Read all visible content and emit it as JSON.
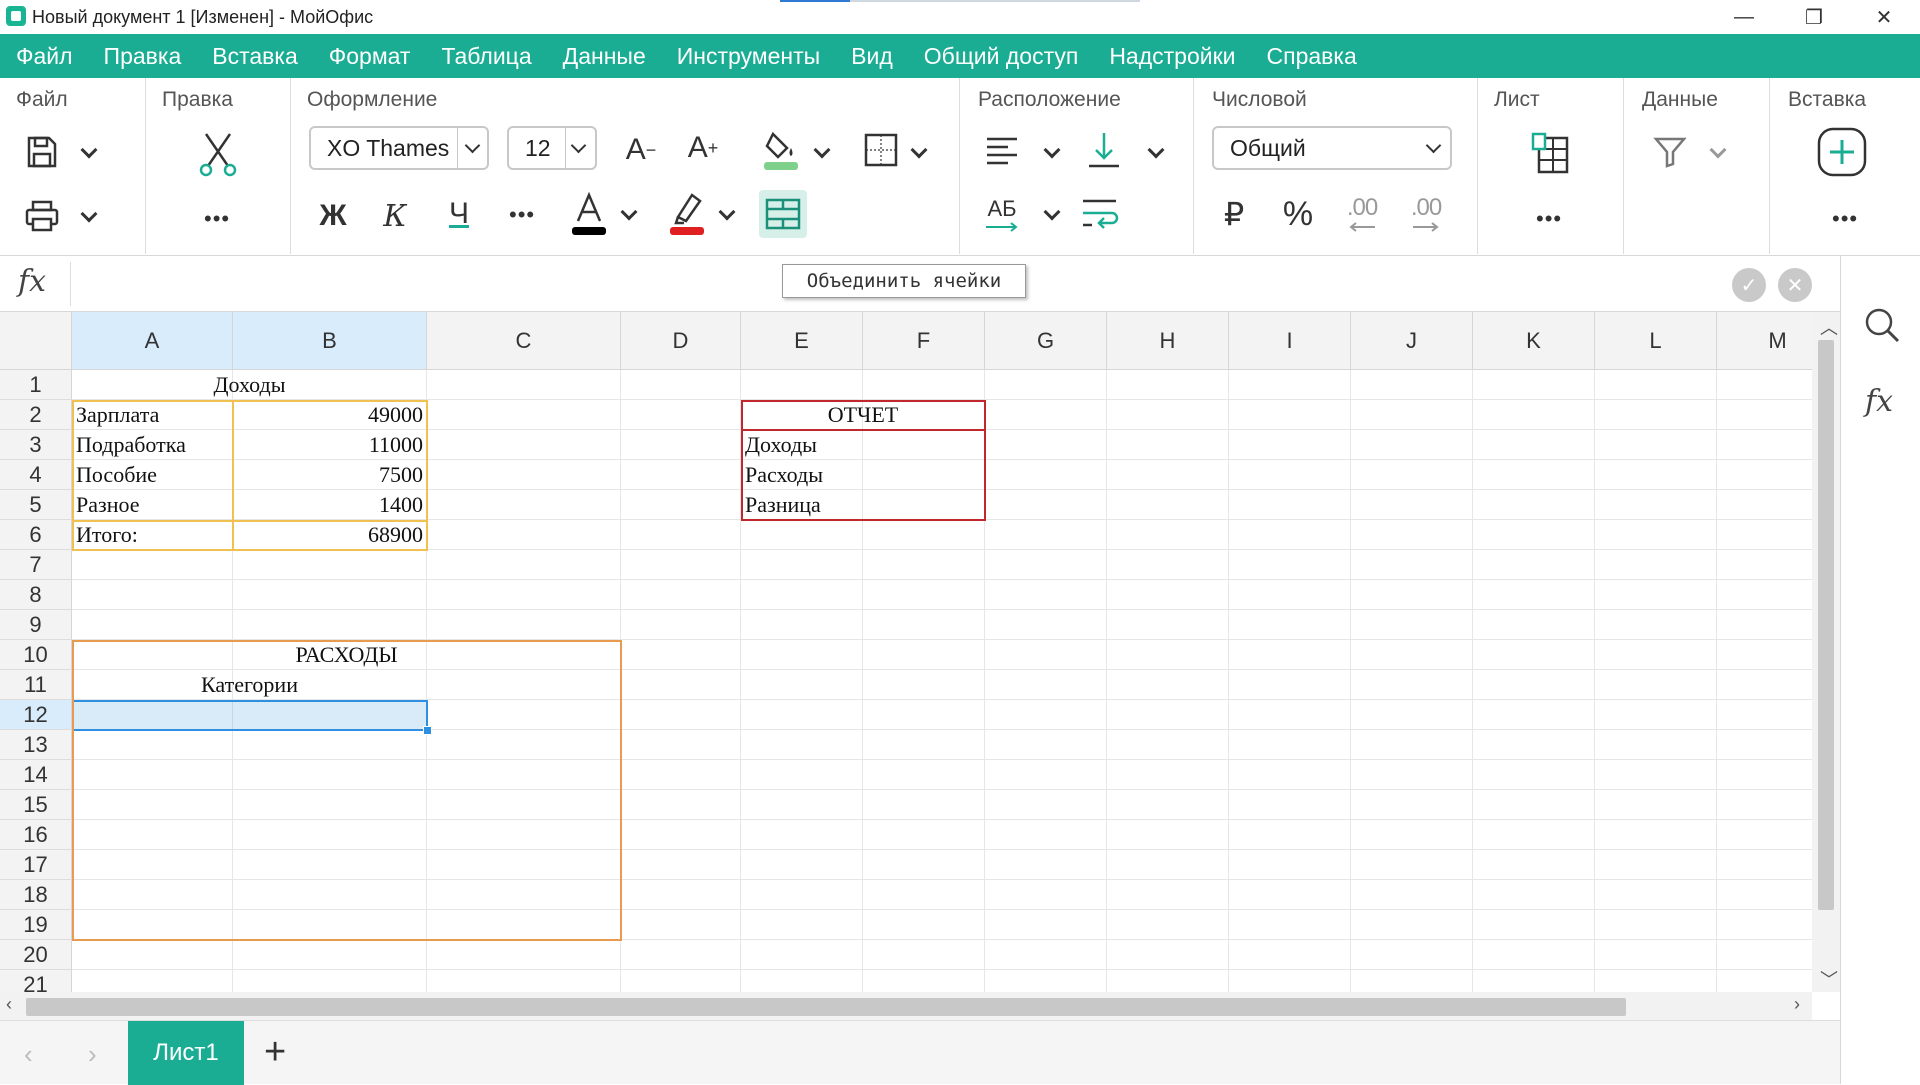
{
  "window": {
    "title": "Новый документ 1 [Изменен] - МойОфис",
    "minimize": "—",
    "restore": "❐",
    "close": "✕"
  },
  "menu": [
    "Файл",
    "Правка",
    "Вставка",
    "Формат",
    "Таблица",
    "Данные",
    "Инструменты",
    "Вид",
    "Общий доступ",
    "Надстройки",
    "Справка"
  ],
  "ribbon": {
    "groups": {
      "file": "Файл",
      "edit": "Правка",
      "format": "Оформление",
      "layout": "Расположение",
      "number": "Числовой",
      "sheet": "Лист",
      "data": "Данные",
      "insert": "Вставка"
    },
    "font_name": "XO Thames",
    "font_size": "12",
    "number_format": "Общий",
    "bold": "Ж",
    "italic": "К",
    "underline": "Ч",
    "font_decrease": "A",
    "font_increase": "A",
    "direction_label": "АБ",
    "currency": "₽",
    "percent": "%",
    "dec_decrease": ".00",
    "dec_increase": ".00",
    "more": "•••",
    "font_color": "#000000",
    "highlight_color": "#e02020",
    "fill_color": "#7fd08a"
  },
  "formula": {
    "fx_label": "fx",
    "value": "",
    "tooltip": "Объединить ячейки"
  },
  "grid": {
    "columns": [
      "A",
      "B",
      "C",
      "D",
      "E",
      "F",
      "G",
      "H",
      "I",
      "J",
      "K",
      "L",
      "M"
    ],
    "rows": [
      "1",
      "2",
      "3",
      "4",
      "5",
      "6",
      "7",
      "8",
      "9",
      "10",
      "11",
      "12",
      "13",
      "14",
      "15",
      "16",
      "17",
      "18",
      "19",
      "20",
      "21"
    ],
    "selected_columns": [
      "A",
      "B"
    ],
    "selected_row": "12",
    "cells": {
      "income_title": "Доходы",
      "rows": [
        {
          "label": "Зарплата",
          "value": "49000"
        },
        {
          "label": "Подработка",
          "value": "11000"
        },
        {
          "label": "Пособие",
          "value": "7500"
        },
        {
          "label": "Разное",
          "value": "1400"
        },
        {
          "label": "Итого:",
          "value": "68900"
        }
      ],
      "report_title": "ОТЧЕТ",
      "report_rows": [
        "Доходы",
        "Расходы",
        "Разница"
      ],
      "expenses_title": "РАСХОДЫ",
      "categories": "Категории"
    },
    "border_colors": {
      "income": "#f0c050",
      "report": "#c0282d",
      "expenses": "#e89a50",
      "selection": "#2f8fe0"
    }
  },
  "sheets": {
    "active": "Лист1",
    "add": "+",
    "prev": "‹",
    "next": "›"
  }
}
